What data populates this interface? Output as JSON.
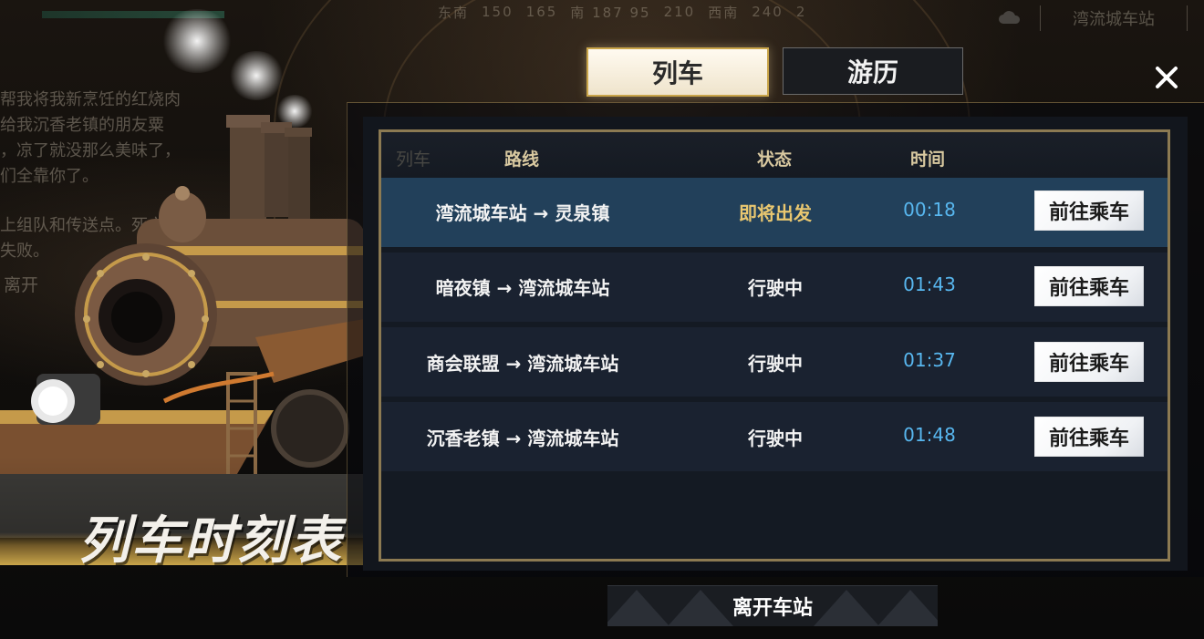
{
  "hud": {
    "compass": [
      "东南",
      "150",
      "165",
      "南 187 95",
      "210",
      "西南",
      "240",
      "2"
    ],
    "location": "湾流城车站"
  },
  "chat": {
    "lines": [
      "帮我将我新烹饪的红烧肉",
      "给我沉香老镇的朋友粟",
      "，凉了就没那么美味了，",
      "们全靠你了。"
    ],
    "lines2": [
      "上组队和传送点。死亡",
      "失败。"
    ],
    "leave_hint": "离开"
  },
  "art": {
    "title": "列车时刻表"
  },
  "tabs": {
    "train": "列车",
    "travel": "游历"
  },
  "table": {
    "headers": {
      "train": "列车",
      "route": "路线",
      "status": "状态",
      "time": "时间"
    },
    "rows": [
      {
        "route": "湾流城车站 → 灵泉镇",
        "status": "即将出发",
        "time": "00:18",
        "button": "前往乘车"
      },
      {
        "route": "暗夜镇 → 湾流城车站",
        "status": "行驶中",
        "time": "01:43",
        "button": "前往乘车"
      },
      {
        "route": "商会联盟 → 湾流城车站",
        "status": "行驶中",
        "time": "01:37",
        "button": "前往乘车"
      },
      {
        "route": "沉香老镇 → 湾流城车站",
        "status": "行驶中",
        "time": "01:48",
        "button": "前往乘车"
      }
    ]
  },
  "footer": {
    "leave_station": "离开车站"
  },
  "colors": {
    "accent_gold": "#c9a54a",
    "status_soon": "#e9c770",
    "time_blue": "#58b7ef",
    "selected_row": "#22405a"
  }
}
